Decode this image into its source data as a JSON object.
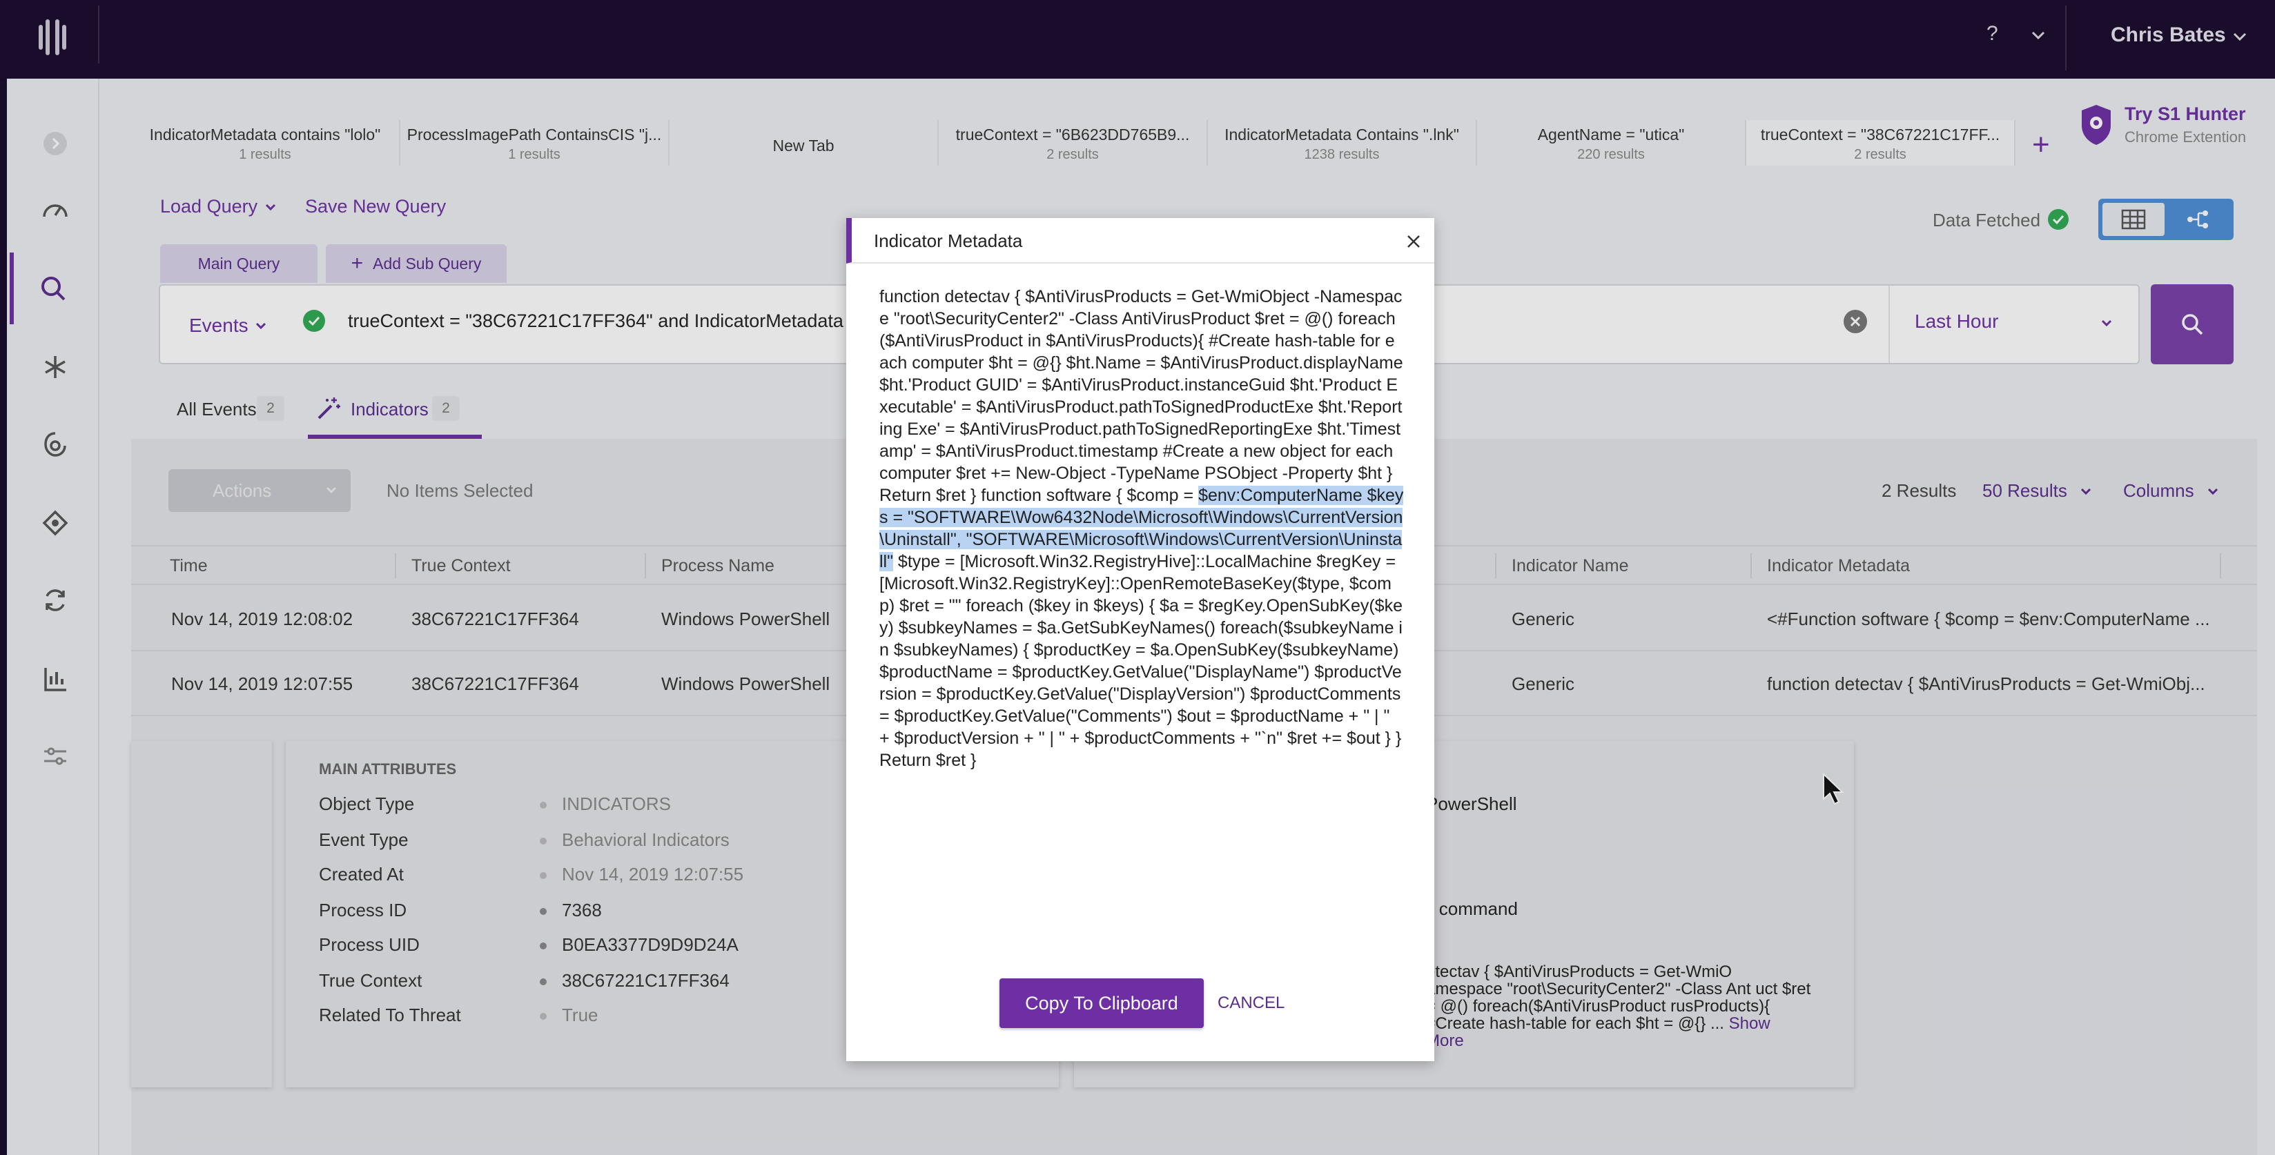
{
  "topbar": {
    "help": "?",
    "user": "Chris Bates"
  },
  "sidebar": {
    "items": [
      "collapse-icon",
      "dashboard-icon",
      "search-icon",
      "threats-icon",
      "network-icon",
      "settings-icon",
      "automation-icon",
      "reports-icon",
      "sliders-icon"
    ]
  },
  "query_tabs": [
    {
      "title": "IndicatorMetadata contains \"lolo\"",
      "count": "1 results"
    },
    {
      "title": "ProcessImagePath ContainsCIS \"j...",
      "count": "1 results"
    },
    {
      "title": "New Tab",
      "count": ""
    },
    {
      "title": "trueContext = \"6B623DD765B9...",
      "count": "2 results"
    },
    {
      "title": "IndicatorMetadata Contains \".lnk\"",
      "count": "1238 results"
    },
    {
      "title": "AgentName = \"utica\"",
      "count": "220 results"
    },
    {
      "title": "trueContext = \"38C67221C17FF...",
      "count": "2 results"
    }
  ],
  "hunter": {
    "title": "Try S1 Hunter",
    "subtitle": "Chrome Extention"
  },
  "query": {
    "load_label": "Load Query",
    "save_label": "Save New Query",
    "data_fetched": "Data Fetched",
    "main_query_tab": "Main Query",
    "add_sub_query": "Add Sub Query",
    "type_select": "Events",
    "text": "trueContext = \"38C67221C17FF364\" and IndicatorMetadata",
    "time_range": "Last Hour"
  },
  "result_tabs": {
    "all_label": "All Events",
    "all_count": "2",
    "ind_label": "Indicators",
    "ind_count": "2"
  },
  "toolbar": {
    "actions": "Actions",
    "selection": "No Items Selected",
    "results": "2 Results",
    "per_page": "50 Results",
    "columns": "Columns"
  },
  "table": {
    "headers": [
      "Time",
      "True Context",
      "Process Name",
      "Indicator Name",
      "Indicator Metadata"
    ],
    "rows": [
      {
        "time": "Nov 14, 2019 12:08:02",
        "context": "38C67221C17FF364",
        "process": "Windows PowerShell",
        "indicator": "Generic",
        "metadata": "<#Function software { $comp = $env:ComputerName ..."
      },
      {
        "time": "Nov 14, 2019 12:07:55",
        "context": "38C67221C17FF364",
        "process": "Windows PowerShell",
        "indicator": "Generic",
        "metadata": "function detectav { $AntiVirusProducts = Get-WmiObj..."
      }
    ]
  },
  "details": {
    "title": "MAIN ATTRIBUTES",
    "attrs": [
      {
        "label": "Object Type",
        "value": "INDICATORS"
      },
      {
        "label": "Event Type",
        "value": "Behavioral Indicators"
      },
      {
        "label": "Created At",
        "value": "Nov 14, 2019 12:07:55"
      },
      {
        "label": "Process ID",
        "value": "7368"
      },
      {
        "label": "Process UID",
        "value": "B0EA3377D9D9D24A"
      },
      {
        "label": "True Context",
        "value": "38C67221C17FF364"
      },
      {
        "label": "Related To Threat",
        "value": "True"
      }
    ],
    "right_line1": "PowerShell",
    "right_line2": "ll command",
    "right_meta": "etectav { $AntiVirusProducts = Get-WmiO amespace \"root\\SecurityCenter2\" -Class Ant uct $ret = @() foreach($AntiVirusProduct rusProducts){ #Create hash-table for each $ht = @{} ...",
    "show_more": "Show More"
  },
  "modal": {
    "title": "Indicator Metadata",
    "body_before": "function detectav { $AntiVirusProducts = Get-WmiObject -Namespace \"root\\SecurityCenter2\" -Class AntiVirusProduct $ret = @() foreach($AntiVirusProduct in $AntiVirusProducts){ #Create hash-table for each computer $ht = @{} $ht.Name = $AntiVirusProduct.displayName $ht.'Product GUID' = $AntiVirusProduct.instanceGuid $ht.'Product Executable' = $AntiVirusProduct.pathToSignedProductExe $ht.'Reporting Exe' = $AntiVirusProduct.pathToSignedReportingExe $ht.'Timestamp' = $AntiVirusProduct.timestamp #Create a new object for each computer $ret += New-Object -TypeName PSObject -Property $ht } Return $ret } function software { $comp = ",
    "body_highlight": "$env:ComputerName $keys = \"SOFTWARE\\Wow6432Node\\Microsoft\\Windows\\CurrentVersion\\Uninstall\", \"SOFTWARE\\Microsoft\\Windows\\CurrentVersion\\Uninstall\"",
    "body_after": " $type = [Microsoft.Win32.RegistryHive]::LocalMachine $regKey = [Microsoft.Win32.RegistryKey]::OpenRemoteBaseKey($type, $comp) $ret = \"\" foreach ($key in $keys) { $a = $regKey.OpenSubKey($key) $subkeyNames = $a.GetSubKeyNames() foreach($subkeyName in $subkeyNames) { $productKey = $a.OpenSubKey($subkeyName) $productName = $productKey.GetValue(\"DisplayName\") $productVersion = $productKey.GetValue(\"DisplayVersion\") $productComments = $productKey.GetValue(\"Comments\") $out = $productName + \" | \" + $productVersion + \" | \" + $productComments + \"`n\" $ret += $out } } Return $ret }",
    "copy_label": "Copy To Clipboard",
    "cancel_label": "CANCEL"
  },
  "colors": {
    "brand": "#6d2fa3",
    "topbar": "#1a0b2c",
    "highlight": "#b9d3f3",
    "success": "#2eaa52"
  }
}
